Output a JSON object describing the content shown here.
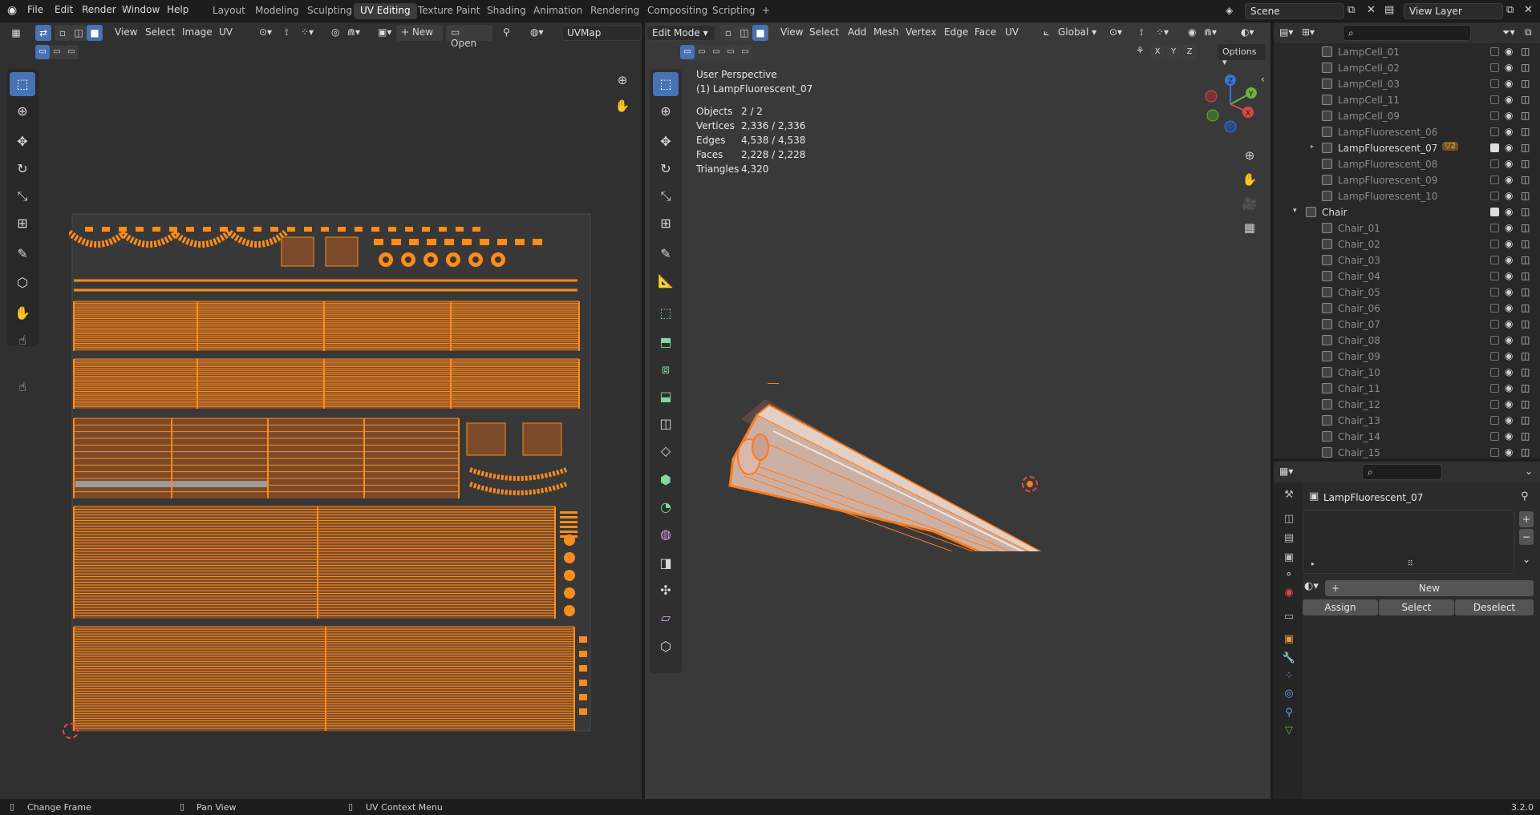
{
  "topbar": {
    "menus": [
      "File",
      "Edit",
      "Render",
      "Window",
      "Help"
    ],
    "workspaces": [
      "Layout",
      "Modeling",
      "Sculpting",
      "UV Editing",
      "Texture Paint",
      "Shading",
      "Animation",
      "Rendering",
      "Compositing",
      "Scripting"
    ],
    "active_workspace": "UV Editing",
    "add_tab": "+",
    "scene_name": "Scene",
    "view_layer_name": "View Layer"
  },
  "uv_editor": {
    "header": {
      "view": "View",
      "select": "Select",
      "image": "Image",
      "uv": "UV",
      "new": "New",
      "open": "Open",
      "uvmap": "UVMap"
    },
    "footer_hint": "Change Frame"
  },
  "viewport": {
    "header": {
      "mode": "Edit Mode",
      "view": "View",
      "select": "Select",
      "add": "Add",
      "mesh": "Mesh",
      "vertex": "Vertex",
      "edge": "Edge",
      "face": "Face",
      "uv": "UV",
      "orientation": "Global",
      "options": "Options"
    },
    "axis_buttons": [
      "X",
      "Y",
      "Z"
    ],
    "info": {
      "perspective": "User Perspective",
      "object": "(1) LampFluorescent_07",
      "stats": [
        {
          "label": "Objects",
          "value": "2 / 2"
        },
        {
          "label": "Vertices",
          "value": "2,336 / 2,336"
        },
        {
          "label": "Edges",
          "value": "4,538 / 4,538"
        },
        {
          "label": "Faces",
          "value": "2,228 / 2,228"
        },
        {
          "label": "Triangles",
          "value": "4,320"
        }
      ]
    },
    "gizmo": {
      "x": "X",
      "y": "Y",
      "z": "Z"
    },
    "footer_hint": "Pan View"
  },
  "outliner": {
    "search_placeholder": "",
    "rows": [
      {
        "name": "LampCell_01",
        "visible": false,
        "checked": false
      },
      {
        "name": "LampCell_02",
        "visible": false,
        "checked": false
      },
      {
        "name": "LampCell_03",
        "visible": false,
        "checked": false
      },
      {
        "name": "LampCell_11",
        "visible": false,
        "checked": false
      },
      {
        "name": "LampCell_09",
        "visible": false,
        "checked": false
      },
      {
        "name": "LampFluorescent_06",
        "visible": false,
        "checked": false
      },
      {
        "name": "LampFluorescent_07",
        "visible": true,
        "checked": true,
        "expandable": true,
        "badge": "2"
      },
      {
        "name": "LampFluorescent_08",
        "visible": false,
        "checked": false
      },
      {
        "name": "LampFluorescent_09",
        "visible": false,
        "checked": false
      },
      {
        "name": "LampFluorescent_10",
        "visible": false,
        "checked": false
      },
      {
        "name": "Chair",
        "visible": true,
        "checked": true,
        "collection": true
      },
      {
        "name": "Chair_01",
        "visible": false,
        "checked": false
      },
      {
        "name": "Chair_02",
        "visible": false,
        "checked": false
      },
      {
        "name": "Chair_03",
        "visible": false,
        "checked": false
      },
      {
        "name": "Chair_04",
        "visible": false,
        "checked": false
      },
      {
        "name": "Chair_05",
        "visible": false,
        "checked": false
      },
      {
        "name": "Chair_06",
        "visible": false,
        "checked": false
      },
      {
        "name": "Chair_07",
        "visible": false,
        "checked": false
      },
      {
        "name": "Chair_08",
        "visible": false,
        "checked": false
      },
      {
        "name": "Chair_09",
        "visible": false,
        "checked": false
      },
      {
        "name": "Chair_10",
        "visible": false,
        "checked": false
      },
      {
        "name": "Chair_11",
        "visible": false,
        "checked": false
      },
      {
        "name": "Chair_12",
        "visible": false,
        "checked": false
      },
      {
        "name": "Chair_13",
        "visible": false,
        "checked": false
      },
      {
        "name": "Chair_14",
        "visible": false,
        "checked": false
      },
      {
        "name": "Chair_15",
        "visible": false,
        "checked": false
      }
    ]
  },
  "properties": {
    "object_name": "LampFluorescent_07",
    "new_label": "New",
    "assign": "Assign",
    "select": "Select",
    "deselect": "Deselect",
    "add": "+",
    "remove": "−",
    "more": "⌄"
  },
  "statusbar": {
    "left": "Change Frame",
    "middle": "Pan View",
    "right": "UV Context Menu",
    "version": "3.2.0"
  },
  "colors": {
    "accent": "#4772b3",
    "uv_orange": "#ff8c1a",
    "selection_orange": "#ff7a1a",
    "bg": "#303030"
  }
}
